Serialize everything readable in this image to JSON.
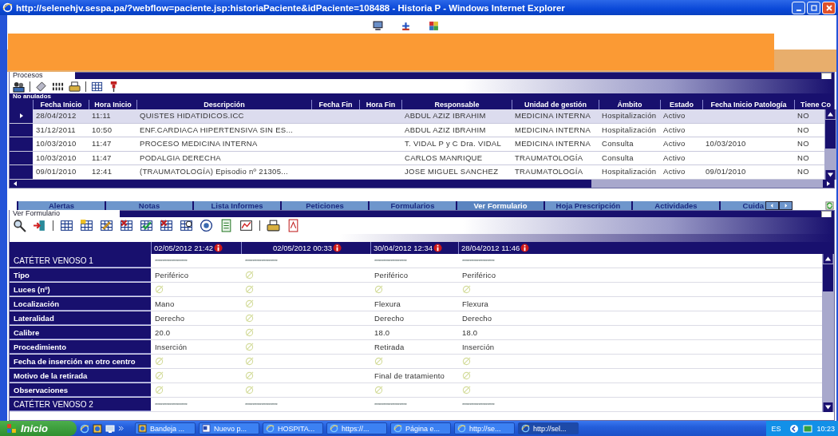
{
  "window": {
    "title": "http://selenehjv.sespa.pa/?webflow=paciente.jsp:historiaPaciente&idPaciente=108488 - Historia P - Windows Internet Explorer"
  },
  "procesos": {
    "title": "Procesos",
    "group": "No anulados",
    "columns": [
      "Fecha Inicio",
      "Hora Inicio",
      "Descripción",
      "Fecha Fin",
      "Hora Fin",
      "Responsable",
      "Unidad de gestión",
      "Ámbito",
      "Estado",
      "Fecha Inicio Patología",
      "Tiene Co"
    ],
    "rows": [
      {
        "selected": true,
        "cells": [
          "28/04/2012",
          "11:11",
          "QUISTES HIDATIDICOS.ICC",
          "",
          "",
          "ABDUL AZIZ IBRAHIM",
          "MEDICINA INTERNA",
          "Hospitalización",
          "Activo",
          "",
          "NO"
        ]
      },
      {
        "selected": false,
        "cells": [
          "31/12/2011",
          "10:50",
          "ENF.CARDIACA HIPERTENSIVA SIN ES...",
          "",
          "",
          "ABDUL AZIZ IBRAHIM",
          "MEDICINA INTERNA",
          "Hospitalización",
          "Activo",
          "",
          "NO"
        ]
      },
      {
        "selected": false,
        "cells": [
          "10/03/2010",
          "11:47",
          "PROCESO MEDICINA INTERNA",
          "",
          "",
          "T. VIDAL P y C Dra. VIDAL",
          "MEDICINA INTERNA",
          "Consulta",
          "Activo",
          "10/03/2010",
          "NO"
        ]
      },
      {
        "selected": false,
        "cells": [
          "10/03/2010",
          "11:47",
          "PODALGIA DERECHA",
          "",
          "",
          "CARLOS MANRIQUE",
          "TRAUMATOLOGÍA",
          "Consulta",
          "Activo",
          "",
          "NO"
        ]
      },
      {
        "selected": false,
        "cells": [
          "09/01/2010",
          "12:41",
          "(TRAUMATOLOGÍA) Episodio nº 21305...",
          "",
          "",
          "JOSE MIGUEL SANCHEZ",
          "TRAUMATOLOGÍA",
          "Hospitalización",
          "Activo",
          "09/01/2010",
          "NO"
        ]
      }
    ]
  },
  "tabs": [
    {
      "label": "Alertas",
      "selected": false
    },
    {
      "label": "Notas",
      "selected": false
    },
    {
      "label": "Lista Informes",
      "selected": false
    },
    {
      "label": "Peticiones",
      "selected": false
    },
    {
      "label": "Formularios",
      "selected": false
    },
    {
      "label": "Ver Formulario",
      "selected": true
    },
    {
      "label": "Hoja Prescripción",
      "selected": false
    },
    {
      "label": "Actividades",
      "selected": false
    },
    {
      "label": "Cuida",
      "selected": false
    }
  ],
  "form": {
    "title": "Ver Formulario",
    "dates": [
      "02/05/2012 21:42",
      "02/05/2012 00:33",
      "30/04/2012 12:34",
      "28/04/2012 11:46"
    ],
    "rows": [
      {
        "kind": "section",
        "label": "CATÉTER VENOSO 1",
        "cells": [
          {
            "kind": "mask",
            "text": "**********************"
          },
          {
            "kind": "mask",
            "text": "**********************"
          },
          {
            "kind": "mask",
            "text": "**********************"
          },
          {
            "kind": "mask",
            "text": "**********************"
          }
        ]
      },
      {
        "kind": "field",
        "label": "Tipo",
        "cells": [
          {
            "kind": "text",
            "text": "Periférico"
          },
          {
            "kind": "empty"
          },
          {
            "kind": "text",
            "text": "Periférico"
          },
          {
            "kind": "text",
            "text": "Periférico"
          }
        ]
      },
      {
        "kind": "field",
        "label": "Luces (nº)",
        "cells": [
          {
            "kind": "empty"
          },
          {
            "kind": "empty"
          },
          {
            "kind": "empty"
          },
          {
            "kind": "empty"
          }
        ]
      },
      {
        "kind": "field",
        "label": "Localización",
        "cells": [
          {
            "kind": "text",
            "text": "Mano"
          },
          {
            "kind": "empty"
          },
          {
            "kind": "text",
            "text": "Flexura"
          },
          {
            "kind": "text",
            "text": "Flexura"
          }
        ]
      },
      {
        "kind": "field",
        "label": "Lateralidad",
        "cells": [
          {
            "kind": "text",
            "text": "Derecho"
          },
          {
            "kind": "empty"
          },
          {
            "kind": "text",
            "text": "Derecho"
          },
          {
            "kind": "text",
            "text": "Derecho"
          }
        ]
      },
      {
        "kind": "field",
        "label": "Calibre",
        "cells": [
          {
            "kind": "text",
            "text": "20.0"
          },
          {
            "kind": "empty"
          },
          {
            "kind": "text",
            "text": "18.0"
          },
          {
            "kind": "text",
            "text": "18.0"
          }
        ]
      },
      {
        "kind": "field",
        "label": "Procedimiento",
        "cells": [
          {
            "kind": "text",
            "text": "Inserción"
          },
          {
            "kind": "empty"
          },
          {
            "kind": "text",
            "text": "Retirada"
          },
          {
            "kind": "text",
            "text": "Inserción"
          }
        ]
      },
      {
        "kind": "field",
        "label": "Fecha de inserción en otro centro",
        "cells": [
          {
            "kind": "empty"
          },
          {
            "kind": "empty"
          },
          {
            "kind": "empty"
          },
          {
            "kind": "empty"
          }
        ]
      },
      {
        "kind": "field",
        "label": "Motivo de la retirada",
        "cells": [
          {
            "kind": "empty"
          },
          {
            "kind": "empty"
          },
          {
            "kind": "text",
            "text": "Final de tratamiento"
          },
          {
            "kind": "empty"
          }
        ]
      },
      {
        "kind": "field",
        "label": "Observaciones",
        "cells": [
          {
            "kind": "empty"
          },
          {
            "kind": "empty"
          },
          {
            "kind": "empty"
          },
          {
            "kind": "empty"
          }
        ]
      },
      {
        "kind": "section",
        "label": "CATÉTER VENOSO 2",
        "cells": [
          {
            "kind": "mask",
            "text": "**********************"
          },
          {
            "kind": "mask",
            "text": "**********************"
          },
          {
            "kind": "mask",
            "text": "**********************"
          },
          {
            "kind": "mask",
            "text": "**********************"
          }
        ]
      }
    ]
  },
  "taskbar": {
    "start": "Inicio",
    "tasks": [
      {
        "kind": "app",
        "label": "Bandeja ...",
        "selected": false
      },
      {
        "kind": "document",
        "label": "Nuevo p...",
        "selected": false
      },
      {
        "kind": "browser",
        "label": "HOSPITA...",
        "selected": false
      },
      {
        "kind": "browser",
        "label": "https://...",
        "selected": false
      },
      {
        "kind": "browser",
        "label": "Página e...",
        "selected": false
      },
      {
        "kind": "browser",
        "label": "http://se...",
        "selected": false
      },
      {
        "kind": "browser",
        "label": "http://sel...",
        "selected": true
      }
    ],
    "language": "ES",
    "clock": "10:23"
  }
}
